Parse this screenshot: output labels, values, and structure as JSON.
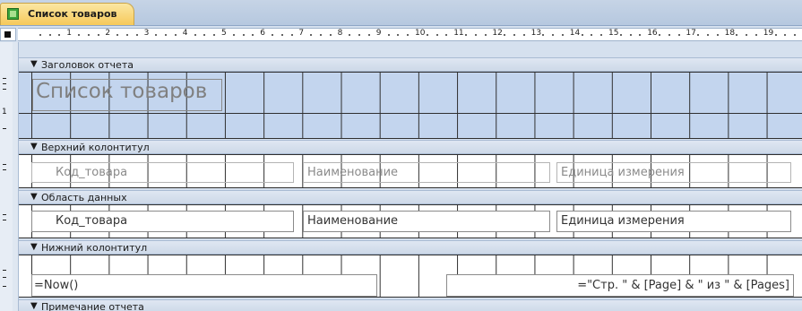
{
  "tab": {
    "label": "Список товаров",
    "icon": "report-icon"
  },
  "ruler": {
    "numbers": [
      "1",
      "2",
      "3",
      "4",
      "5",
      "6",
      "7",
      "8",
      "9",
      "10",
      "11",
      "12",
      "13",
      "14",
      "15",
      "16",
      "17",
      "18",
      "19"
    ]
  },
  "vruler": {
    "marks": [
      "1"
    ]
  },
  "sections": {
    "report_header": "Заголовок отчета",
    "page_header": "Верхний колонтитул",
    "detail": "Область данных",
    "page_footer": "Нижний колонтитул",
    "report_footer": "Примечание отчета"
  },
  "report_header": {
    "title": "Список товаров"
  },
  "page_header": {
    "labels": [
      "Код_товара",
      "Наименование",
      "Единица измерения"
    ]
  },
  "detail": {
    "fields": [
      "Код_товара",
      "Наименование",
      "Единица измерения"
    ]
  },
  "page_footer": {
    "date_expr": "=Now()",
    "page_expr": "=\"Стр. \" & [Page] & \" из \" & [Pages]"
  },
  "colors": {
    "selected_section": "#c3d5ee",
    "tab": "#f6c95a",
    "grid_line": "#2f2f2f"
  }
}
